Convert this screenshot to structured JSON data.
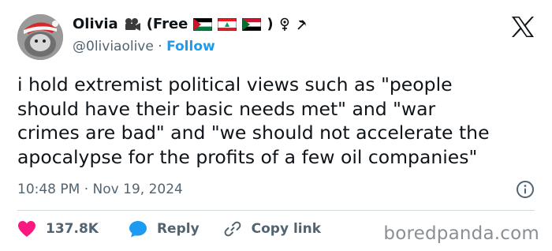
{
  "tweet": {
    "author_name": "Olivia",
    "author_handle": "@0liviaolive",
    "separator_dot": "·",
    "follow_label": "Follow",
    "name_suffix_open": "(Free",
    "name_suffix_close": ")",
    "body_lines": [
      "i hold extremist political views such as \"people",
      "should have their basic needs met\" and \"war",
      "crimes are bad\" and \"we should not accelerate the",
      "apocalypse for the profits of a few oil companies\""
    ],
    "time": "10:48 PM",
    "meta_separator": "·",
    "date": "Nov 19, 2024",
    "like_count": "137.8K",
    "reply_label": "Reply",
    "copy_link_label": "Copy link",
    "name_icons": [
      "movie-camera-icon",
      "palestine-flag-icon",
      "lebanon-flag-icon",
      "sudan-flag-icon",
      "feminist-symbol-icon",
      "hammer-sickle-icon"
    ]
  },
  "watermark": "boredpanda.com",
  "colors": {
    "like": "#f91880",
    "reply": "#1d9bf0",
    "follow": "#1d9bf0",
    "secondary_text": "#536471",
    "primary_text": "#0f1419"
  }
}
